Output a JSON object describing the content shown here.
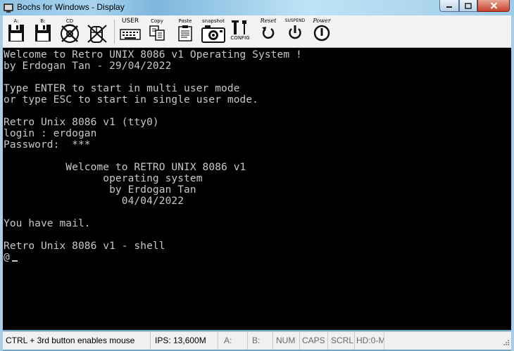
{
  "window": {
    "title": "Bochs for Windows - Display",
    "accent": "#8ec3e6"
  },
  "toolbar": {
    "floppy_a_label": "A:",
    "floppy_b_label": "B:",
    "cdrom_label": "CD",
    "user_label": "USER",
    "copy_label": "Copy",
    "paste_label": "Paste",
    "snapshot_label": "snapshot",
    "config_label": "CONFIG",
    "reset_label": "Reset",
    "suspend_label": "SUSPEND",
    "power_label": "Power"
  },
  "terminal": {
    "text": "Welcome to Retro UNIX 8086 v1 Operating System !\nby Erdogan Tan - 29/04/2022\n\nType ENTER to start in multi user mode\nor type ESC to start in single user mode.\n\nRetro Unix 8086 v1 (tty0)\nlogin : erdogan\nPassword:  ***\n\n          Welcome to RETRO UNIX 8086 v1\n                operating system\n                 by Erdogan Tan\n                   04/04/2022\n\nYou have mail.\n\nRetro Unix 8086 v1 - shell\n@",
    "background": "#000000",
    "foreground": "#c8c8c8"
  },
  "statusbar": {
    "hint": "CTRL + 3rd button enables mouse",
    "ips": "IPS: 13,600M",
    "drive_a": "A:",
    "drive_b": "B:",
    "num": "NUM",
    "caps": "CAPS",
    "scrl": "SCRL",
    "hd": "HD:0-M"
  }
}
